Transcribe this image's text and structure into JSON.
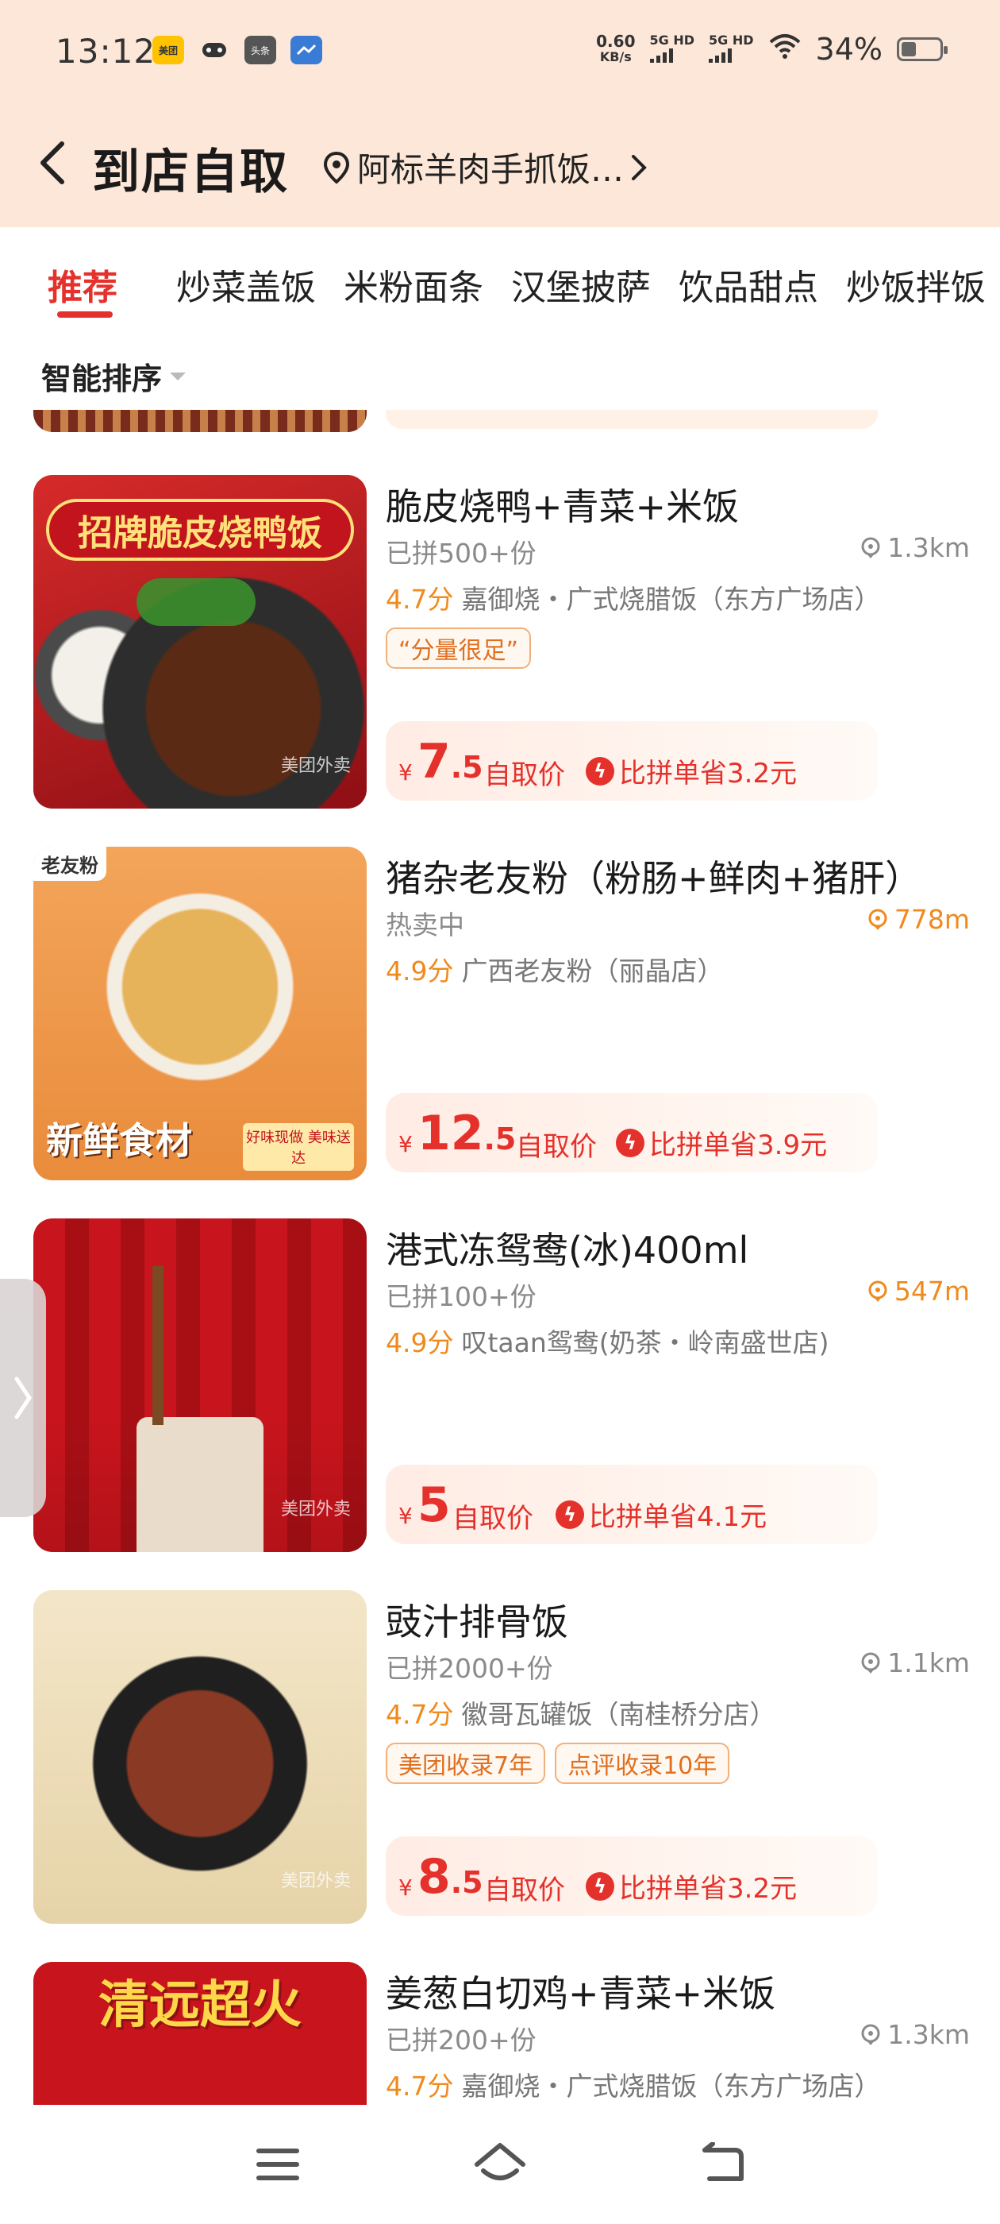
{
  "status_bar": {
    "time": "13:12",
    "app_icons": [
      "meituan-icon",
      "gamepad-icon",
      "toutiao-icon",
      "weather-icon"
    ],
    "app_labels": {
      "meituan": "美团",
      "toutiao": "头条"
    },
    "net_speed_value": "0.60",
    "net_speed_unit": "KB/s",
    "signal1_label": "5G HD",
    "signal2_label": "5G HD",
    "battery": "34%",
    "battery_level": 0.34
  },
  "header": {
    "title": "到店自取",
    "store": "阿标羊肉手抓饭…"
  },
  "tabs": [
    {
      "label": "推荐",
      "active": true
    },
    {
      "label": "炒菜盖饭"
    },
    {
      "label": "米粉面条"
    },
    {
      "label": "汉堡披萨"
    },
    {
      "label": "饮品甜点"
    },
    {
      "label": "炒饭拌饭"
    }
  ],
  "sort": {
    "label": "智能排序"
  },
  "items": [
    {
      "name": "脆皮烧鸭+青菜+米饭",
      "sold": "已拼500+份",
      "distance": "1.3km",
      "score": "4.7分",
      "shop": "嘉御烧・广式烧腊饭（东方广场店）",
      "badges": [
        "“分量很足”"
      ],
      "price_int": "7",
      "price_dec": ".5",
      "price_label": "自取价",
      "save": "比拼单省3.2元",
      "thumb_tag": "招牌脆皮烧鸭饭",
      "thumb_wm": "美团外卖"
    },
    {
      "name": "猪杂老友粉（粉肠+鲜肉+猪肝）",
      "sold": "热卖中",
      "distance": "778m",
      "score": "4.9分",
      "shop": "广西老友粉（丽晶店）",
      "badges": [],
      "price_int": "12",
      "price_dec": ".5",
      "price_label": "自取价",
      "save": "比拼单省3.9元",
      "thumb_corner": "老友粉",
      "thumb_bottom": "新鲜食材",
      "thumb_seal": "好味现做 美味送达"
    },
    {
      "name": "港式冻鸳鸯(冰)400ml",
      "sold": "已拼100+份",
      "distance": "547m",
      "score": "4.9分",
      "shop": "叹taan鸳鸯(奶茶・岭南盛世店)",
      "badges": [],
      "price_int": "5",
      "price_dec": "",
      "price_label": "自取价",
      "save": "比拼单省4.1元",
      "thumb_wm": "美团外卖"
    },
    {
      "name": "豉汁排骨饭",
      "sold": "已拼2000+份",
      "distance": "1.1km",
      "score": "4.7分",
      "shop": "徽哥瓦罐饭（南桂桥分店）",
      "badges": [
        "美团收录7年",
        "点评收录10年"
      ],
      "price_int": "8",
      "price_dec": ".5",
      "price_label": "自取价",
      "save": "比拼单省3.2元",
      "thumb_wm": "美团外卖"
    },
    {
      "name": "姜葱白切鸡+青菜+米饭",
      "sold": "已拼200+份",
      "distance": "1.3km",
      "score": "4.7分",
      "shop": "嘉御烧・广式烧腊饭（东方广场店）",
      "badges": [],
      "thumb_tag": "清远超火"
    }
  ],
  "colors": {
    "accent": "#e4312b",
    "header_bg": "#fde7d8",
    "orange": "#f08a1c"
  }
}
